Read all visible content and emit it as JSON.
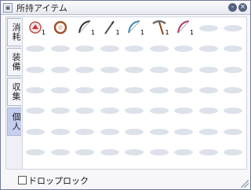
{
  "window": {
    "title": "所持アイテム",
    "minimize_label": "-",
    "close_label": "×"
  },
  "tabs": [
    {
      "label": "消耗",
      "active": false
    },
    {
      "label": "装備",
      "active": false
    },
    {
      "label": "収集",
      "active": false
    },
    {
      "label": "個人",
      "active": true
    }
  ],
  "items": [
    {
      "icon": "red-orb-icon",
      "qty": "1"
    },
    {
      "icon": "ring-bow-icon",
      "qty": ""
    },
    {
      "icon": "bow-icon",
      "qty": "1"
    },
    {
      "icon": "arrow-icon",
      "qty": "1"
    },
    {
      "icon": "bow-icon",
      "qty": "1"
    },
    {
      "icon": "pickaxe-icon",
      "qty": "1"
    },
    {
      "icon": "bow-icon",
      "qty": "1"
    }
  ],
  "grid": {
    "cols": 9,
    "rows": 7
  },
  "drop_lock": {
    "label": "ドロップロック",
    "checked": false
  }
}
